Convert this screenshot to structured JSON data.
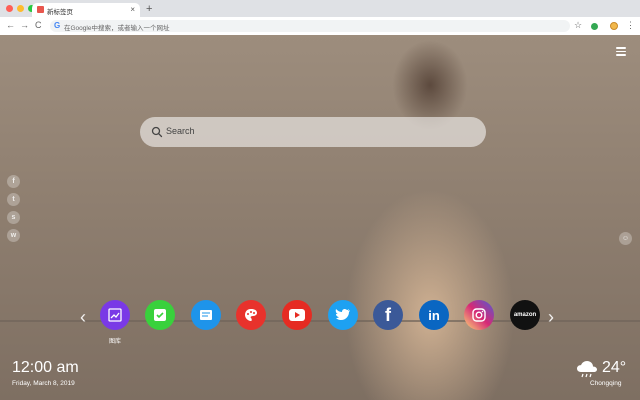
{
  "browser": {
    "tab_title": "新标签页",
    "tab_close": "×",
    "new_tab": "+",
    "url_placeholder": "在Google中搜索，或者输入一个网址",
    "back": "←",
    "forward": "→",
    "reload": "C",
    "star": "☆",
    "menu": "⋮"
  },
  "search": {
    "placeholder": "Search"
  },
  "apps": [
    {
      "label": "图库",
      "icon": "gallery-icon",
      "color": "#7a39e6"
    },
    {
      "label": "",
      "icon": "tasks-icon",
      "color": "#39d13c"
    },
    {
      "label": "",
      "icon": "notes-icon",
      "color": "#1e94ea"
    },
    {
      "label": "",
      "icon": "paint-icon",
      "color": "#e8322c"
    },
    {
      "label": "",
      "icon": "youtube-icon",
      "color": "#e62b22"
    },
    {
      "label": "",
      "icon": "twitter-icon",
      "color": "#1da1f2"
    },
    {
      "label": "",
      "icon": "facebook-icon",
      "color": "#3b5998"
    },
    {
      "label": "",
      "icon": "linkedin-icon",
      "color": "#0a66c2"
    },
    {
      "label": "",
      "icon": "instagram-icon",
      "color": "#d62976"
    },
    {
      "label": "amazon",
      "icon": "amazon-icon",
      "color": "#111111"
    }
  ],
  "nav": {
    "left_arrow": "‹",
    "right_arrow": "›"
  },
  "clock": {
    "time": "12:00 am",
    "date": "Friday, March 8, 2019"
  },
  "weather": {
    "temperature": "24°",
    "city": "Chongqing"
  }
}
